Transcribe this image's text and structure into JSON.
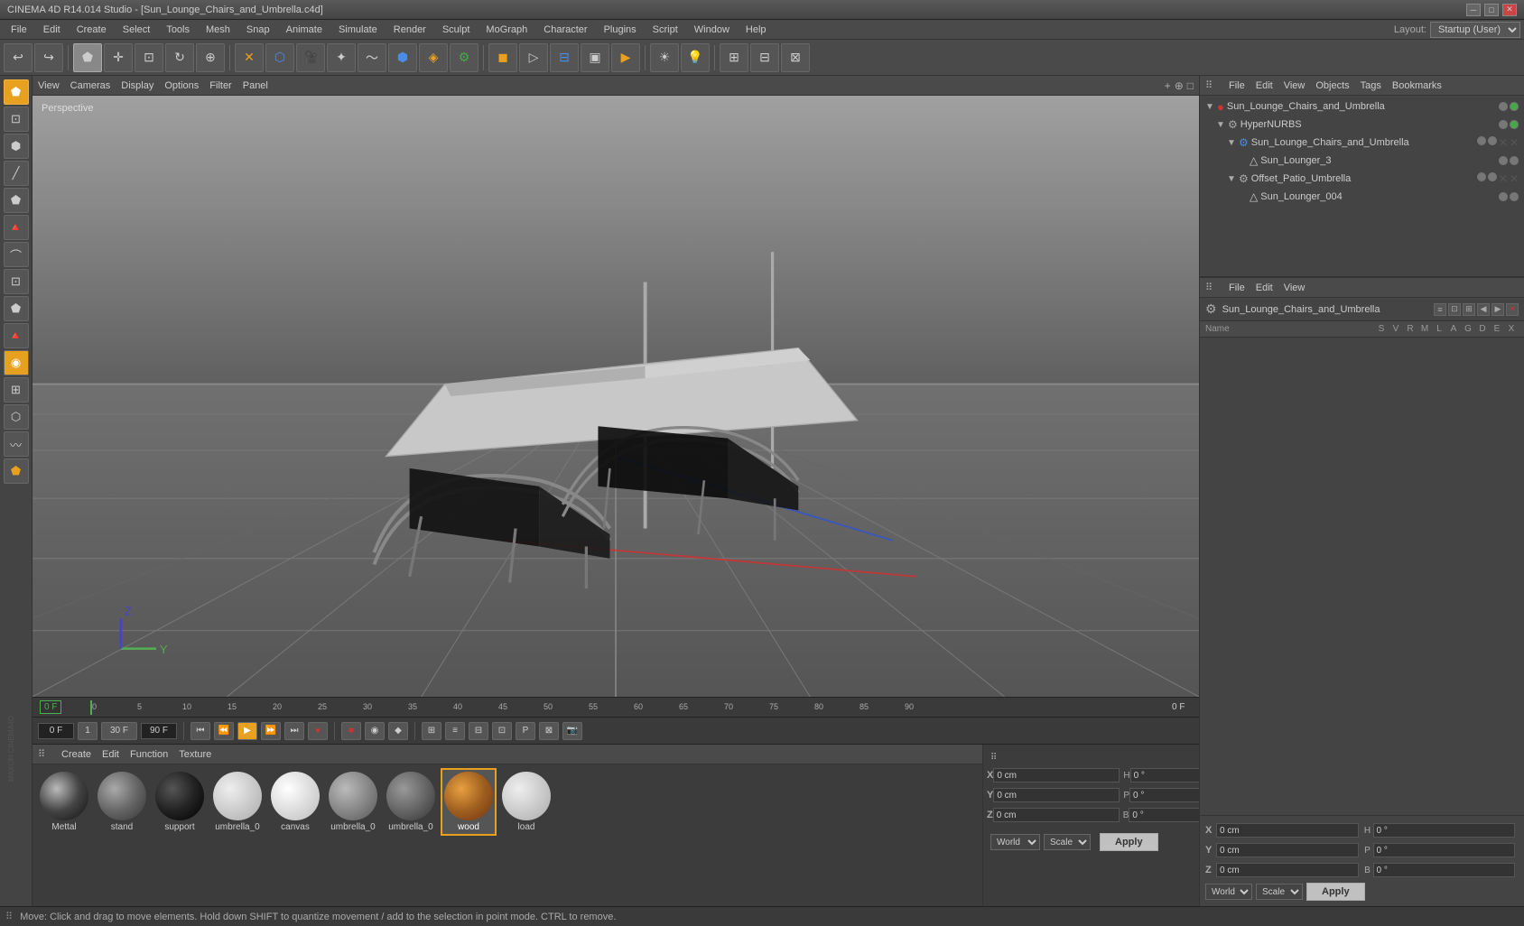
{
  "titlebar": {
    "title": "CINEMA 4D R14.014 Studio - [Sun_Lounge_Chairs_and_Umbrella.c4d]",
    "controls": [
      "minimize",
      "maximize",
      "close"
    ]
  },
  "menubar": {
    "items": [
      "File",
      "Edit",
      "Create",
      "Select",
      "Tools",
      "Mesh",
      "Snap",
      "Animate",
      "Simulate",
      "Render",
      "Sculpt",
      "MoGraph",
      "Character",
      "Plugins",
      "Script",
      "Window",
      "Help"
    ],
    "layout_label": "Layout:",
    "layout_value": "Startup (User)"
  },
  "toolbar": {
    "tools": [
      "undo",
      "redo",
      "model",
      "move",
      "scale",
      "rotate",
      "object-axis",
      "null",
      "object",
      "camera",
      "light",
      "spline",
      "nurbs",
      "deformer",
      "generator",
      "material",
      "timeline",
      "render",
      "render-region",
      "render-view",
      "render-active",
      "display",
      "light-icon"
    ]
  },
  "left_sidebar": {
    "tools": [
      "select",
      "move",
      "scale",
      "rotate",
      "poly-pen",
      "edge",
      "poly",
      "point",
      "live-selection",
      "path",
      "arch",
      "bend",
      "twist",
      "taper",
      "bulge",
      "shear",
      "wrap"
    ]
  },
  "viewport": {
    "perspective_label": "Perspective",
    "menus": [
      "View",
      "Cameras",
      "Display",
      "Options",
      "Filter",
      "Panel"
    ],
    "icons": [
      "+",
      "⊕",
      "□"
    ]
  },
  "object_manager": {
    "header_items": [
      "File",
      "Edit",
      "View",
      "Objects",
      "Tags",
      "Bookmarks"
    ],
    "tree": [
      {
        "id": "sun_lounge_root",
        "label": "Sun_Lounge_Chairs_and_Umbrella",
        "icon": "🔴",
        "indent": 0,
        "expanded": true,
        "has_arrow": true
      },
      {
        "id": "hypernurbs",
        "label": "HyperNURBS",
        "icon": "⚙",
        "indent": 1,
        "expanded": true,
        "has_arrow": true
      },
      {
        "id": "sun_lounge_chairs",
        "label": "Sun_Lounge_Chairs_and_Umbrella",
        "icon": "🔵",
        "indent": 2,
        "expanded": true,
        "has_arrow": true
      },
      {
        "id": "sun_lounger_3",
        "label": "Sun_Lounger_3",
        "icon": "△",
        "indent": 3,
        "expanded": false,
        "has_arrow": false
      },
      {
        "id": "offset_patio",
        "label": "Offset_Patio_Umbrella",
        "icon": "⚙",
        "indent": 2,
        "expanded": true,
        "has_arrow": true
      },
      {
        "id": "sun_lounger_004",
        "label": "Sun_Lounger_004",
        "icon": "△",
        "indent": 3,
        "expanded": false,
        "has_arrow": false
      }
    ]
  },
  "attr_manager": {
    "header_items": [
      "File",
      "Edit",
      "View"
    ],
    "name_row": {
      "label": "Sun_Lounge_Chairs_and_Umbrella",
      "icon": "⚙"
    },
    "columns": [
      "Name",
      "S",
      "V",
      "R",
      "M",
      "L",
      "A",
      "G",
      "D",
      "E",
      "X"
    ]
  },
  "coordinates": {
    "rows": [
      {
        "axis": "X",
        "pos": "0 cm",
        "secondary_label": "H",
        "secondary_val": "0 °"
      },
      {
        "axis": "Y",
        "pos": "0 cm",
        "secondary_label": "P",
        "secondary_val": "0 °"
      },
      {
        "axis": "Z",
        "pos": "0 cm",
        "secondary_label": "B",
        "secondary_val": "0 °"
      }
    ],
    "position_dropdown": "World",
    "size_dropdown": "Scale",
    "apply_label": "Apply"
  },
  "timeline": {
    "frame_start": "0 F",
    "frame_end": "90 F",
    "current_frame": "0 F",
    "fps": "30",
    "markers": [
      "0",
      "5",
      "10",
      "15",
      "20",
      "25",
      "30",
      "35",
      "40",
      "45",
      "50",
      "55",
      "60",
      "65",
      "70",
      "75",
      "80",
      "85",
      "90"
    ]
  },
  "playback": {
    "current_frame_input": "0 F",
    "frame_step": "1 F",
    "fps_display": "30 F",
    "end_frame": "90 F"
  },
  "materials": {
    "header_items": [
      "Create",
      "Edit",
      "Function",
      "Texture"
    ],
    "items": [
      {
        "name": "Mettal",
        "color1": "#2a2a2a",
        "color2": "#888",
        "type": "metal"
      },
      {
        "name": "stand",
        "color1": "#555",
        "color2": "#999",
        "type": "plastic"
      },
      {
        "name": "support",
        "color1": "#111",
        "color2": "#333",
        "type": "dark"
      },
      {
        "name": "umbrella_0",
        "color1": "#ccc",
        "color2": "#eee",
        "type": "light"
      },
      {
        "name": "canvas",
        "color1": "#ddd",
        "color2": "#fff",
        "type": "white"
      },
      {
        "name": "umbrella_0",
        "color1": "#888",
        "color2": "#aaa",
        "type": "gray"
      },
      {
        "name": "umbrella_0",
        "color1": "#666",
        "color2": "#999",
        "type": "darkgray"
      },
      {
        "name": "wood",
        "color1": "#c8842a",
        "color2": "#a06020",
        "type": "wood",
        "selected": true
      },
      {
        "name": "load",
        "color1": "#ccc",
        "color2": "#eee",
        "type": "light2"
      }
    ]
  },
  "statusbar": {
    "text": "Move: Click and drag to move elements. Hold down SHIFT to quantize movement / add to the selection in point mode. CTRL to remove."
  }
}
